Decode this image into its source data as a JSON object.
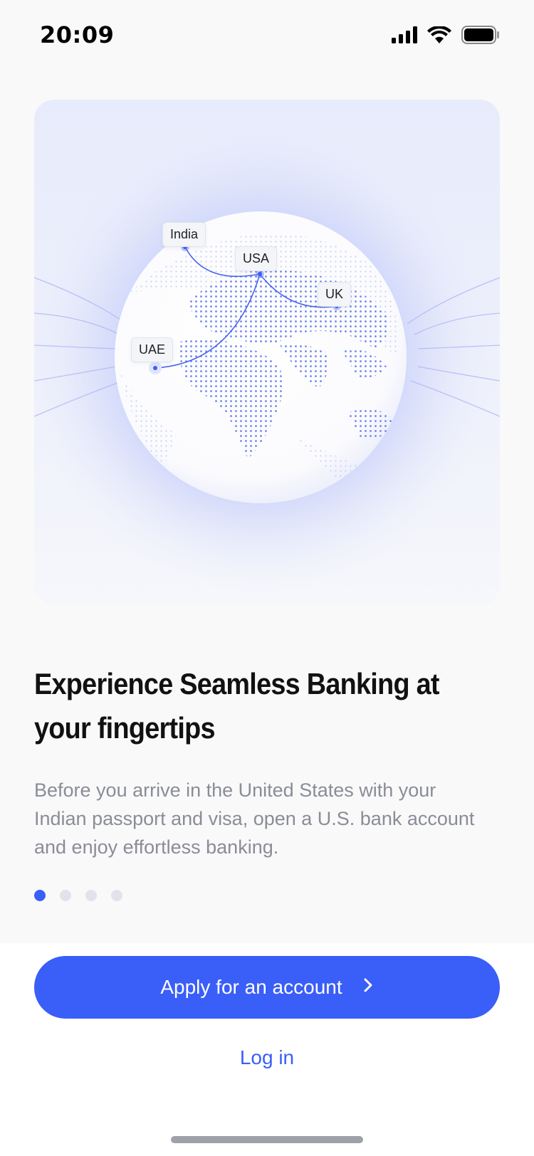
{
  "status_bar": {
    "time": "20:09",
    "icons": [
      "signal-icon",
      "wifi-icon",
      "battery-icon"
    ]
  },
  "hero": {
    "labels": {
      "india": "India",
      "usa": "USA",
      "uk": "UK",
      "uae": "UAE"
    }
  },
  "onboarding": {
    "title": "Experience Seamless Banking at your fingertips",
    "description": "Before you arrive in the United States with your Indian passport and visa, open a U.S. bank account and enjoy effortless banking.",
    "page_indicator": {
      "total": 4,
      "current": 1
    }
  },
  "actions": {
    "apply_label": "Apply for an account",
    "apply_icon": "chevron-right-icon",
    "login_label": "Log in"
  },
  "colors": {
    "accent": "#3a5ef8",
    "background": "#f9f9fa",
    "muted_text": "#8a8d96",
    "dot_inactive": "#e1e3ea"
  }
}
